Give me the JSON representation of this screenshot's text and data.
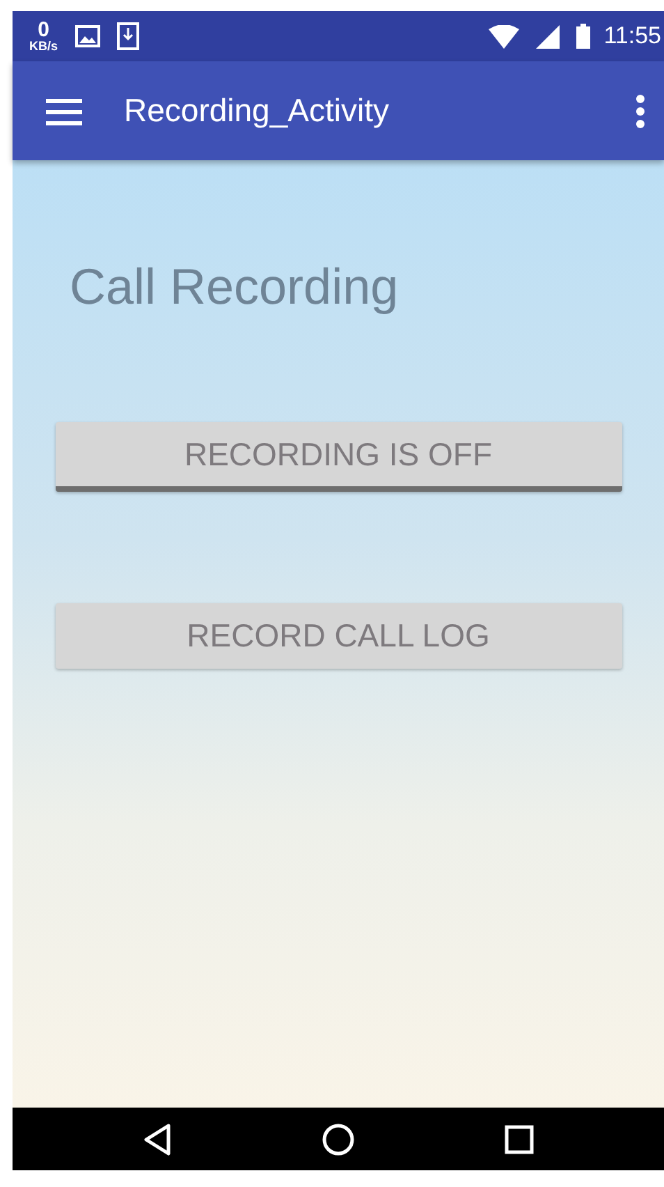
{
  "status_bar": {
    "speed_value": "0",
    "speed_unit": "KB/s",
    "time": "11:55"
  },
  "toolbar": {
    "title": "Recording_Activity"
  },
  "heading": "Call Recording",
  "buttons": [
    {
      "kind": "toggle",
      "label": "RECORDING IS OFF",
      "on": false
    },
    {
      "kind": "plain",
      "label": "RECORD CALL LOG"
    }
  ]
}
